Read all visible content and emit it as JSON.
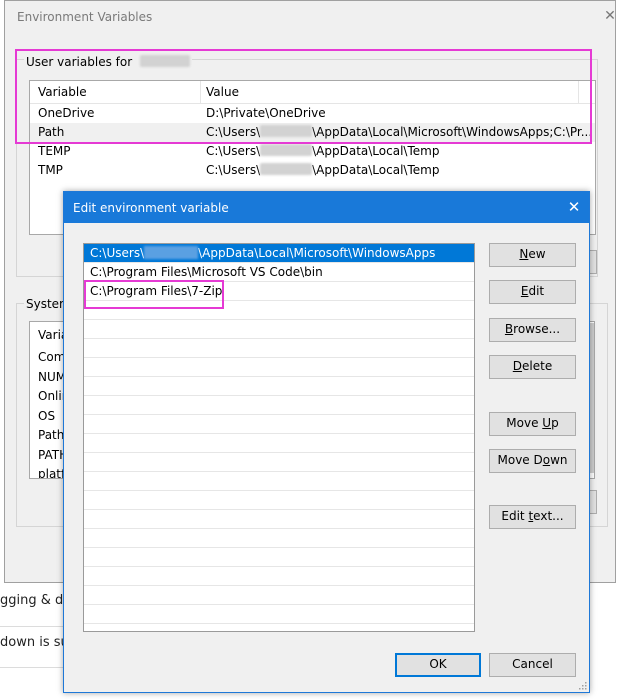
{
  "background": {
    "text1": "gging & dr",
    "text2": "down is supp"
  },
  "outer_dialog": {
    "title": "Environment Variables",
    "user_group_label": "User variables for",
    "user_columns": [
      "Variable",
      "Value"
    ],
    "user_rows": [
      {
        "variable": "OneDrive",
        "value": "D:\\Private\\OneDrive",
        "redacted": false
      },
      {
        "variable": "Path",
        "value_pre": "C:\\Users\\",
        "value_post": "\\AppData\\Local\\Microsoft\\WindowsApps;C:\\Pr...",
        "redacted": true
      },
      {
        "variable": "TEMP",
        "value_pre": "C:\\Users\\",
        "value_post": "\\AppData\\Local\\Temp",
        "redacted": true
      },
      {
        "variable": "TMP",
        "value_pre": "C:\\Users\\",
        "value_post": "\\AppData\\Local\\Temp",
        "redacted": true
      }
    ],
    "system_group_label": "System",
    "system_column": "Varia",
    "system_rows": [
      "Com",
      "NUM",
      "Onlin",
      "OS",
      "Path",
      "PATH",
      "platfo"
    ]
  },
  "edit_dialog": {
    "title": "Edit environment variable",
    "paths": [
      {
        "pre": "C:\\Users\\",
        "post": "\\AppData\\Local\\Microsoft\\WindowsApps",
        "redacted": true
      },
      {
        "pre": "C:\\Program Files\\Microsoft VS Code\\bin",
        "post": "",
        "redacted": false
      },
      {
        "pre": "C:\\Program Files\\7-Zip",
        "post": "",
        "redacted": false
      }
    ],
    "buttons": {
      "new": {
        "pre": "",
        "u": "N",
        "post": "ew"
      },
      "edit": {
        "pre": "",
        "u": "E",
        "post": "dit"
      },
      "browse": {
        "pre": "",
        "u": "B",
        "post": "rowse..."
      },
      "delete": {
        "pre": "",
        "u": "D",
        "post": "elete"
      },
      "move_up": {
        "pre": "Move ",
        "u": "U",
        "post": "p"
      },
      "move_down": {
        "pre": "Move D",
        "u": "o",
        "post": "wn"
      },
      "edit_text": {
        "pre": "Edit ",
        "u": "t",
        "post": "ext..."
      },
      "ok": "OK",
      "cancel": "Cancel"
    }
  },
  "colors": {
    "accent": "#0078d7",
    "titlebar": "#1979d9",
    "highlight_annotation": "#e53ad4"
  }
}
